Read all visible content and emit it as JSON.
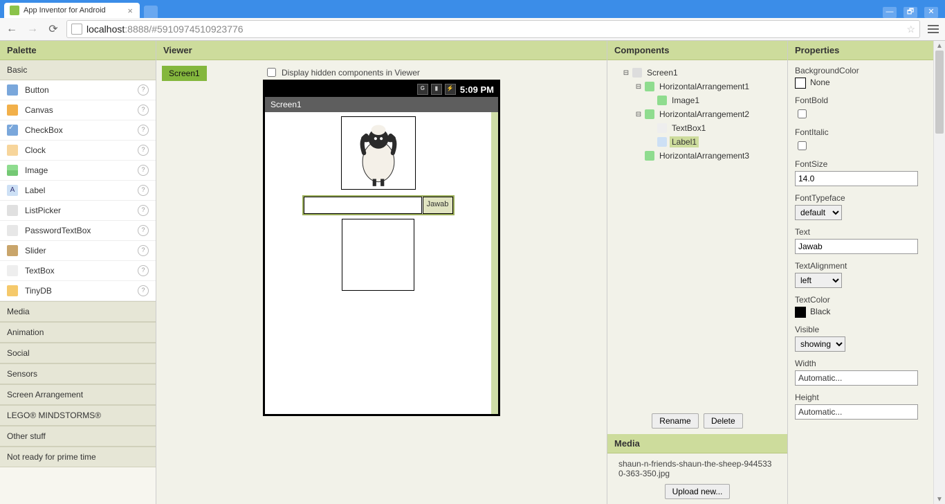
{
  "browser": {
    "tab_title": "App Inventor for Android",
    "url_host": "localhost",
    "url_port_path": ":8888/#5910974510923776",
    "wincaption_minimize": "—",
    "wincaption_restore": "🗗",
    "wincaption_close": "✕"
  },
  "headers": {
    "palette": "Palette",
    "viewer": "Viewer",
    "components": "Components",
    "properties": "Properties",
    "media": "Media"
  },
  "palette": {
    "basic": "Basic",
    "items": [
      {
        "label": "Button",
        "icon": "button"
      },
      {
        "label": "Canvas",
        "icon": "canvas"
      },
      {
        "label": "CheckBox",
        "icon": "checkbox"
      },
      {
        "label": "Clock",
        "icon": "clock"
      },
      {
        "label": "Image",
        "icon": "image"
      },
      {
        "label": "Label",
        "icon": "label"
      },
      {
        "label": "ListPicker",
        "icon": "listpicker"
      },
      {
        "label": "PasswordTextBox",
        "icon": "password"
      },
      {
        "label": "Slider",
        "icon": "slider"
      },
      {
        "label": "TextBox",
        "icon": "textbox"
      },
      {
        "label": "TinyDB",
        "icon": "tinydb"
      }
    ],
    "categories": [
      "Media",
      "Animation",
      "Social",
      "Sensors",
      "Screen Arrangement",
      "LEGO® MINDSTORMS®",
      "Other stuff",
      "Not ready for prime time"
    ]
  },
  "viewer": {
    "screen_chip": "Screen1",
    "hidden_label": "Display hidden components in Viewer",
    "status_time": "5:09 PM",
    "phone_title": "Screen1",
    "jawab_label": "Jawab"
  },
  "components": {
    "tree": {
      "screen": "Screen1",
      "h1": "HorizontalArrangement1",
      "image1": "Image1",
      "h2": "HorizontalArrangement2",
      "textbox1": "TextBox1",
      "label1": "Label1",
      "h3": "HorizontalArrangement3"
    },
    "rename": "Rename",
    "delete": "Delete"
  },
  "media": {
    "file1": "shaun-n-friends-shaun-the-sheep-9445330-363-350.jpg",
    "upload": "Upload new..."
  },
  "properties": {
    "backgroundcolor_label": "BackgroundColor",
    "backgroundcolor_value": "None",
    "fontbold_label": "FontBold",
    "fontitalic_label": "FontItalic",
    "fontsize_label": "FontSize",
    "fontsize_value": "14.0",
    "fonttypeface_label": "FontTypeface",
    "fonttypeface_value": "default",
    "text_label": "Text",
    "text_value": "Jawab",
    "textalignment_label": "TextAlignment",
    "textalignment_value": "left",
    "textcolor_label": "TextColor",
    "textcolor_value": "Black",
    "visible_label": "Visible",
    "visible_value": "showing",
    "width_label": "Width",
    "width_value": "Automatic...",
    "height_label": "Height",
    "height_value": "Automatic..."
  }
}
